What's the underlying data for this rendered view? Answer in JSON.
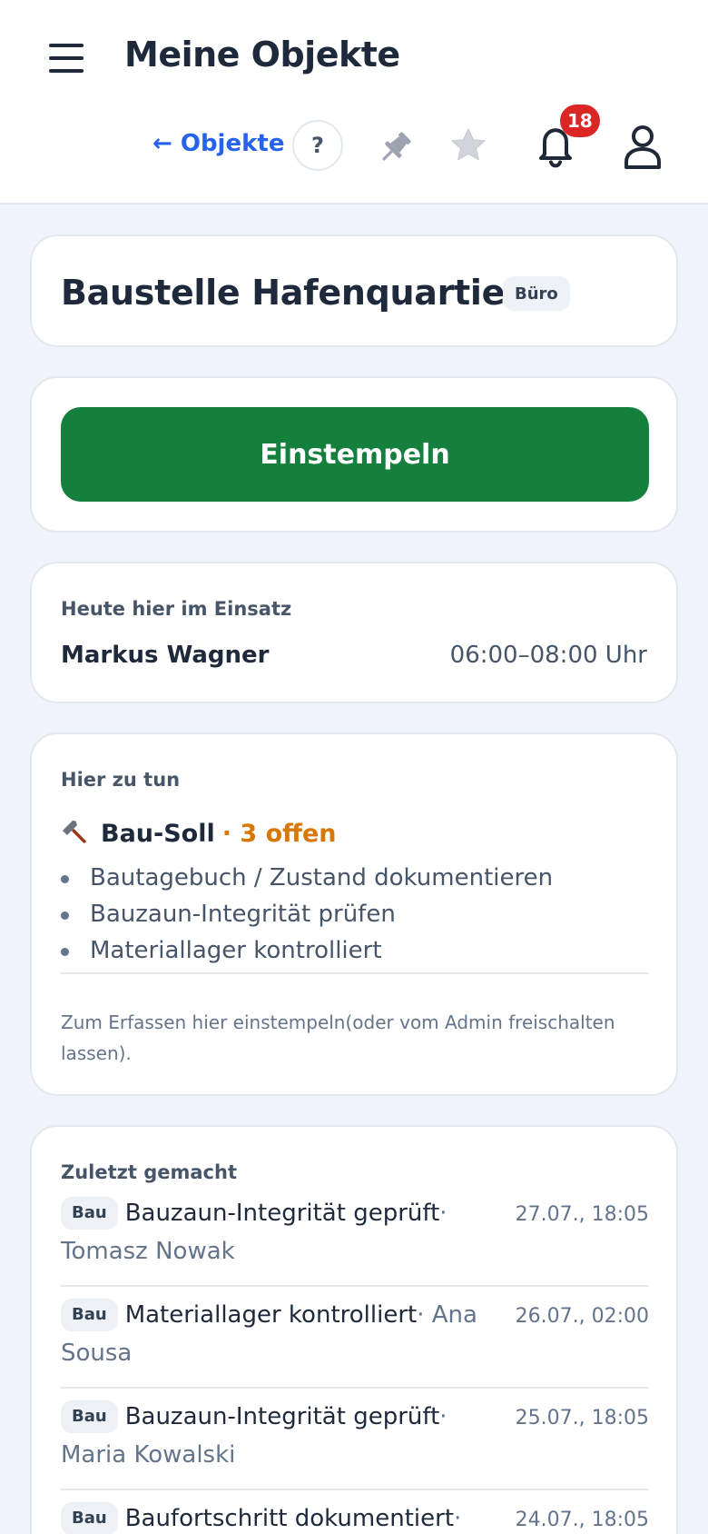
{
  "header": {
    "title": "Meine Objekte",
    "back_label": "← Objekte",
    "help_label": "?",
    "notification_count": "18"
  },
  "site": {
    "name": "Baustelle Hafenquartier",
    "tag": "Büro"
  },
  "stamp": {
    "button_label": "Einstempeln"
  },
  "today": {
    "label": "Heute hier im Einsatz",
    "person": "Markus Wagner",
    "time": "06:00–08:00 Uhr"
  },
  "todo": {
    "label": "Hier zu tun",
    "group_name": "Bau-Soll",
    "open_count": "· 3 offen",
    "items": [
      "Bautagebuch / Zustand dokumentieren",
      "Bauzaun-Integrität prüfen",
      "Materiallager kontrolliert"
    ],
    "note": "Zum Erfassen hier einstempeln(oder vom Admin freischalten lassen)."
  },
  "recent": {
    "label": "Zuletzt gemacht",
    "entries": [
      {
        "tag": "Bau",
        "task": "Bauzaun-Integrität geprüft",
        "person": "· Tomasz Nowak",
        "time": "27.07., 18:05"
      },
      {
        "tag": "Bau",
        "task": "Materiallager kontrolliert",
        "person": "· Ana Sousa",
        "time": "26.07., 02:00"
      },
      {
        "tag": "Bau",
        "task": "Bauzaun-Integrität geprüft",
        "person": "· Maria Kowalski",
        "time": "25.07., 18:05"
      },
      {
        "tag": "Bau",
        "task": "Baufortschritt dokumentiert",
        "person": "·",
        "time": "24.07., 18:05"
      }
    ]
  }
}
